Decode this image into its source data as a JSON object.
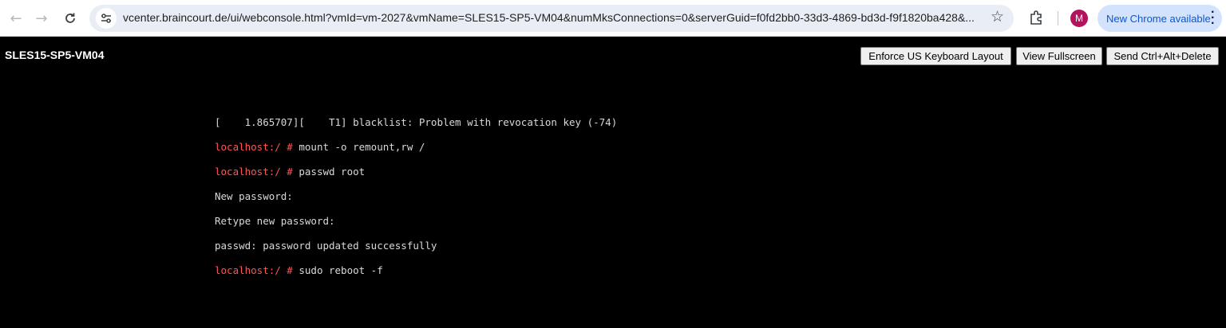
{
  "browser": {
    "back_icon": "arrow-left-icon",
    "forward_icon": "arrow-right-icon",
    "reload_icon": "reload-icon",
    "url": "vcenter.braincourt.de/ui/webconsole.html?vmId=vm-2027&vmName=SLES15-SP5-VM04&numMksConnections=0&serverGuid=f0fd2bb0-33d3-4869-bd3d-f9f1820ba428&...",
    "avatar_initial": "M",
    "update_label": "New Chrome available",
    "accent_color": "#0b57d0"
  },
  "console": {
    "vm_name": "SLES15-SP5-VM04",
    "buttons": {
      "keyboard_layout": "Enforce US Keyboard Layout",
      "fullscreen": "View Fullscreen",
      "ctrl_alt_delete": "Send Ctrl+Alt+Delete"
    }
  },
  "terminal": {
    "prompt": "localhost:/ #",
    "prompt_color": "#ff5555",
    "lines": [
      {
        "prompt": "",
        "text": "[    1.865707][    T1] blacklist: Problem with revocation key (-74)"
      },
      {
        "prompt": "localhost:/ #",
        "text": " mount -o remount,rw /"
      },
      {
        "prompt": "localhost:/ #",
        "text": " passwd root"
      },
      {
        "prompt": "",
        "text": "New password:"
      },
      {
        "prompt": "",
        "text": "Retype new password:"
      },
      {
        "prompt": "",
        "text": "passwd: password updated successfully"
      },
      {
        "prompt": "localhost:/ #",
        "text": " sudo reboot -f"
      }
    ]
  }
}
